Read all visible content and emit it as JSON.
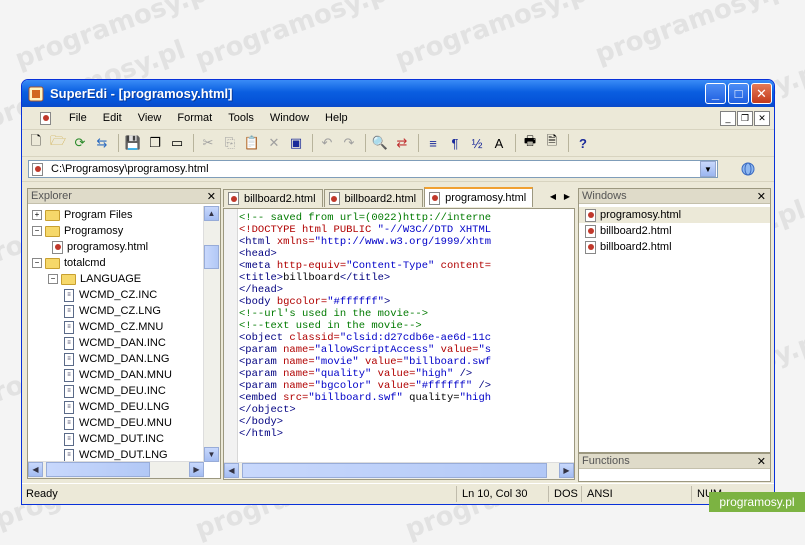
{
  "watermark": {
    "text": "programosy.pl"
  },
  "window": {
    "title": "SuperEdi - [programosy.html]",
    "controls": {
      "minimize": "_",
      "maximize": "□",
      "close": "✕"
    }
  },
  "menu": {
    "items": [
      "File",
      "Edit",
      "View",
      "Format",
      "Tools",
      "Window",
      "Help"
    ]
  },
  "path": {
    "value": "C:\\Programosy\\programosy.html"
  },
  "explorer": {
    "title": "Explorer",
    "nodes": [
      {
        "label": "Program Files",
        "type": "folder",
        "toggle": "+"
      },
      {
        "label": "Programosy",
        "type": "folder",
        "toggle": "−"
      },
      {
        "label": "programosy.html",
        "type": "html"
      },
      {
        "label": "totalcmd",
        "type": "folder",
        "toggle": "−"
      },
      {
        "label": "LANGUAGE",
        "type": "folder",
        "toggle": "−"
      },
      {
        "label": "WCMD_CZ.INC",
        "type": "file"
      },
      {
        "label": "WCMD_CZ.LNG",
        "type": "file"
      },
      {
        "label": "WCMD_CZ.MNU",
        "type": "file"
      },
      {
        "label": "WCMD_DAN.INC",
        "type": "file"
      },
      {
        "label": "WCMD_DAN.LNG",
        "type": "file"
      },
      {
        "label": "WCMD_DAN.MNU",
        "type": "file"
      },
      {
        "label": "WCMD_DEU.INC",
        "type": "file"
      },
      {
        "label": "WCMD_DEU.LNG",
        "type": "file"
      },
      {
        "label": "WCMD_DEU.MNU",
        "type": "file"
      },
      {
        "label": "WCMD_DUT.INC",
        "type": "file"
      },
      {
        "label": "WCMD_DUT.LNG",
        "type": "file"
      }
    ]
  },
  "tabs": [
    "billboard2.html",
    "billboard2.html",
    "programosy.html"
  ],
  "active_tab": 2,
  "code": [
    [
      [
        "c-com",
        "<!-- saved from url=(0022)http://interne"
      ]
    ],
    [
      [
        "c-attr",
        "<!DOCTYPE html PUBLIC "
      ],
      [
        "c-str",
        "\"-//W3C//DTD XHTML"
      ]
    ],
    [
      [
        "c-tag",
        "<html "
      ],
      [
        "c-attr",
        "xmlns="
      ],
      [
        "c-str",
        "\"http://www.w3.org/1999/xhtm"
      ]
    ],
    [
      [
        "c-tag",
        "<head>"
      ]
    ],
    [
      [
        "c-tag",
        "<meta "
      ],
      [
        "c-attr",
        "http-equiv="
      ],
      [
        "c-str",
        "\"Content-Type\" "
      ],
      [
        "c-attr",
        "content="
      ]
    ],
    [
      [
        "c-tag",
        "<title>"
      ],
      [
        "c-txt",
        "billboard"
      ],
      [
        "c-tag",
        "</title>"
      ]
    ],
    [
      [
        "c-tag",
        "</head>"
      ]
    ],
    [
      [
        "c-tag",
        "<body "
      ],
      [
        "c-attr",
        "bgcolor="
      ],
      [
        "c-str",
        "\"#ffffff\""
      ],
      [
        "c-tag",
        ">"
      ]
    ],
    [
      [
        "c-com",
        "<!--url's used in the movie-->"
      ]
    ],
    [
      [
        "c-com",
        "<!--text used in the movie-->"
      ]
    ],
    [
      [
        "c-tag",
        "<object "
      ],
      [
        "c-attr",
        "classid="
      ],
      [
        "c-str",
        "\"clsid:d27cdb6e-ae6d-11c"
      ]
    ],
    [
      [
        "c-tag",
        "<param "
      ],
      [
        "c-attr",
        "name="
      ],
      [
        "c-str",
        "\"allowScriptAccess\" "
      ],
      [
        "c-attr",
        "value="
      ],
      [
        "c-str",
        "\"s"
      ]
    ],
    [
      [
        "c-tag",
        "<param "
      ],
      [
        "c-attr",
        "name="
      ],
      [
        "c-str",
        "\"movie\" "
      ],
      [
        "c-attr",
        "value="
      ],
      [
        "c-str",
        "\"billboard.swf"
      ]
    ],
    [
      [
        "c-tag",
        "<param "
      ],
      [
        "c-attr",
        "name="
      ],
      [
        "c-str",
        "\"quality\" "
      ],
      [
        "c-attr",
        "value="
      ],
      [
        "c-str",
        "\"high\" "
      ],
      [
        "c-tag",
        "/>"
      ]
    ],
    [
      [
        "c-tag",
        "<param "
      ],
      [
        "c-attr",
        "name="
      ],
      [
        "c-str",
        "\"bgcolor\" "
      ],
      [
        "c-attr",
        "value="
      ],
      [
        "c-str",
        "\"#ffffff\" "
      ],
      [
        "c-tag",
        "/>"
      ]
    ],
    [
      [
        "c-tag",
        "<embed "
      ],
      [
        "c-attr",
        "src="
      ],
      [
        "c-str",
        "\"billboard.swf\" "
      ],
      [
        "c-txt",
        "quality="
      ],
      [
        "c-str",
        "\"high"
      ]
    ],
    [
      [
        "c-tag",
        "</object>"
      ]
    ],
    [
      [
        "c-tag",
        "</body>"
      ]
    ],
    [
      [
        "c-tag",
        "</html>"
      ]
    ]
  ],
  "windows_panel": {
    "title": "Windows",
    "items": [
      "programosy.html",
      "billboard2.html",
      "billboard2.html"
    ]
  },
  "functions_panel": {
    "title": "Functions"
  },
  "status": {
    "text": "Ready",
    "position": "Ln 10, Col 30",
    "line_ending": "DOS",
    "encoding": "ANSI",
    "num": "NUM"
  },
  "badge": {
    "text": "programosy.pl"
  }
}
